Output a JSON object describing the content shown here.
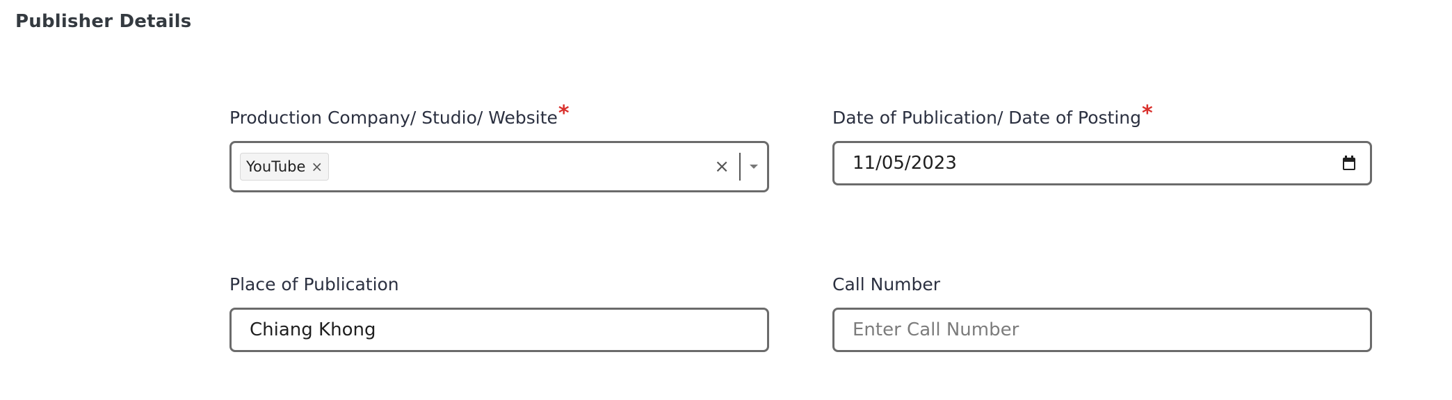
{
  "section": {
    "title": "Publisher Details"
  },
  "fields": {
    "production_company": {
      "label": "Production Company/ Studio/ Website",
      "required_mark": "*",
      "selected_tags": [
        {
          "label": "YouTube",
          "remove_glyph": "×"
        }
      ],
      "clear_glyph": "×"
    },
    "date_of_publication": {
      "label": "Date of Publication/ Date of Posting",
      "required_mark": "*",
      "value": "11/05/2023",
      "icon": "calendar-icon"
    },
    "place_of_publication": {
      "label": "Place of Publication",
      "value": "Chiang Khong",
      "placeholder": ""
    },
    "call_number": {
      "label": "Call Number",
      "value": "",
      "placeholder": "Enter Call Number"
    }
  },
  "colors": {
    "required": "#d9302c",
    "border": "#6b6b6b",
    "label": "#2b3040"
  }
}
